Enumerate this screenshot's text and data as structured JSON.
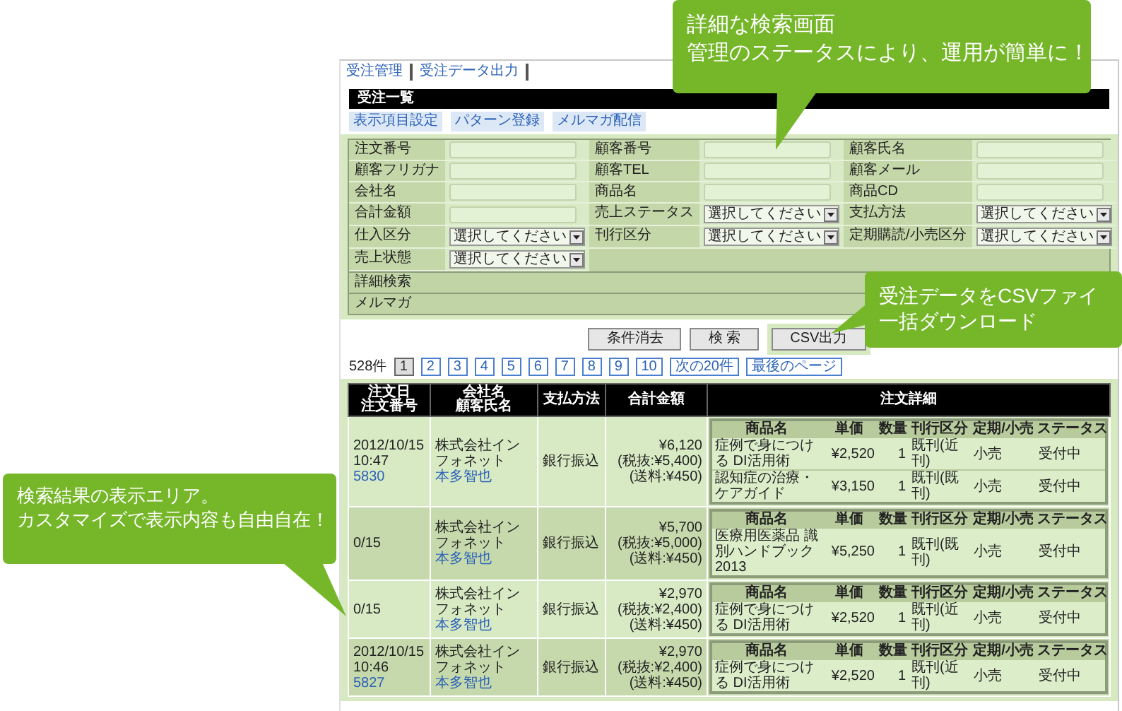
{
  "nav": [
    {
      "label": "受注管理"
    },
    {
      "label": "受注データ出力"
    }
  ],
  "title": "受注一覧",
  "actions": [
    "表示項目設定",
    "パターン登録",
    "メルマガ配信"
  ],
  "search_form": {
    "fields": [
      {
        "label": "注文番号",
        "kind": "text"
      },
      {
        "label": "顧客番号",
        "kind": "text"
      },
      {
        "label": "顧客氏名",
        "kind": "text"
      },
      {
        "label": "顧客フリガナ",
        "kind": "text"
      },
      {
        "label": "顧客TEL",
        "kind": "text"
      },
      {
        "label": "顧客メール",
        "kind": "text"
      },
      {
        "label": "会社名",
        "kind": "text"
      },
      {
        "label": "商品名",
        "kind": "text"
      },
      {
        "label": "商品CD",
        "kind": "text"
      },
      {
        "label": "合計金額",
        "kind": "text"
      },
      {
        "label": "売上ステータス",
        "kind": "select",
        "value": "選択してください"
      },
      {
        "label": "支払方法",
        "kind": "select",
        "value": "選択してください"
      },
      {
        "label": "仕入区分",
        "kind": "select",
        "value": "選択してください"
      },
      {
        "label": "刊行区分",
        "kind": "select",
        "value": "選択してください"
      },
      {
        "label": "定期購読/小売区分",
        "kind": "select",
        "value": "選択してください"
      },
      {
        "label": "売上状態",
        "kind": "select",
        "value": "選択してください"
      }
    ],
    "sections": [
      "詳細検索",
      "メルマガ"
    ]
  },
  "buttons": [
    {
      "label": "条件消去",
      "highlighted": false
    },
    {
      "label": "検 索",
      "highlighted": false
    },
    {
      "label": "CSV出力",
      "highlighted": true
    }
  ],
  "pagination": {
    "count": "528件",
    "pages": [
      {
        "label": "1",
        "selected": true
      },
      {
        "label": "2",
        "selected": false
      },
      {
        "label": "3",
        "selected": false
      },
      {
        "label": "4",
        "selected": false
      },
      {
        "label": "5",
        "selected": false
      },
      {
        "label": "6",
        "selected": false
      },
      {
        "label": "7",
        "selected": false
      },
      {
        "label": "8",
        "selected": false
      },
      {
        "label": "9",
        "selected": false
      },
      {
        "label": "10",
        "selected": false
      }
    ],
    "next": "次の20件",
    "last": "最後のページ"
  },
  "results": {
    "columns": [
      [
        "注文日",
        "注文番号"
      ],
      [
        "会社名",
        "顧客氏名"
      ],
      [
        "支払方法"
      ],
      [
        "合計金額"
      ],
      [
        "注文詳細"
      ]
    ],
    "rows": [
      {
        "date": "2012/10/15",
        "time": "10:47",
        "number": "5830",
        "company": "株式会社インフォネット",
        "customer": "本多智也",
        "payment": "銀行振込",
        "total": "¥6,120",
        "tax": "(税抜:¥5,400)",
        "shipping": "(送料:¥450)",
        "detail_columns": [
          "商品名",
          "単価",
          "数量",
          "刊行区分",
          "定期/小売",
          "ステータス"
        ],
        "items": [
          [
            "症例で身につける DI活用術",
            "¥2,520",
            "1",
            "既刊(近刊)",
            "小売",
            "受付中"
          ],
          [
            "認知症の治療・ケアガイド",
            "¥3,150",
            "1",
            "既刊(既刊)",
            "小売",
            "受付中"
          ]
        ]
      },
      {
        "date": "0/15",
        "company": "株式会社インフォネット",
        "customer": "本多智也",
        "payment": "銀行振込",
        "total": "¥5,700",
        "tax": "(税抜:¥5,000)",
        "shipping": "(送料:¥450)",
        "detail_columns": [
          "商品名",
          "単価",
          "数量",
          "刊行区分",
          "定期/小売",
          "ステータス"
        ],
        "items": [
          [
            "医療用医薬品 識別ハンドブック2013",
            "¥5,250",
            "1",
            "既刊(既刊)",
            "小売",
            "受付中"
          ]
        ]
      },
      {
        "date": "0/15",
        "company": "株式会社インフォネット",
        "customer": "本多智也",
        "payment": "銀行振込",
        "total": "¥2,970",
        "tax": "(税抜:¥2,400)",
        "shipping": "(送料:¥450)",
        "detail_columns": [
          "商品名",
          "単価",
          "数量",
          "刊行区分",
          "定期/小売",
          "ステータス"
        ],
        "items": [
          [
            "症例で身につける DI活用術",
            "¥2,520",
            "1",
            "既刊(近刊)",
            "小売",
            "受付中"
          ]
        ]
      },
      {
        "date": "2012/10/15",
        "time": "10:46",
        "number": "5827",
        "company": "株式会社インフォネット",
        "customer": "本多智也",
        "payment": "銀行振込",
        "total": "¥2,970",
        "tax": "(税抜:¥2,400)",
        "shipping": "(送料:¥450)",
        "detail_columns": [
          "商品名",
          "単価",
          "数量",
          "刊行区分",
          "定期/小売",
          "ステータス"
        ],
        "items": [
          [
            "症例で身につける DI活用術",
            "¥2,520",
            "1",
            "既刊(近刊)",
            "小売",
            "受付中"
          ]
        ]
      }
    ]
  },
  "callouts": [
    {
      "lines": [
        "詳細な検索画面",
        "管理のステータスにより、運用が簡単に！"
      ]
    },
    {
      "lines": [
        "受注データをCSVファイ",
        "一括ダウンロード"
      ]
    },
    {
      "lines": [
        "検索結果の表示エリア。",
        "カスタマイズで表示内容も自由自在！"
      ]
    }
  ]
}
